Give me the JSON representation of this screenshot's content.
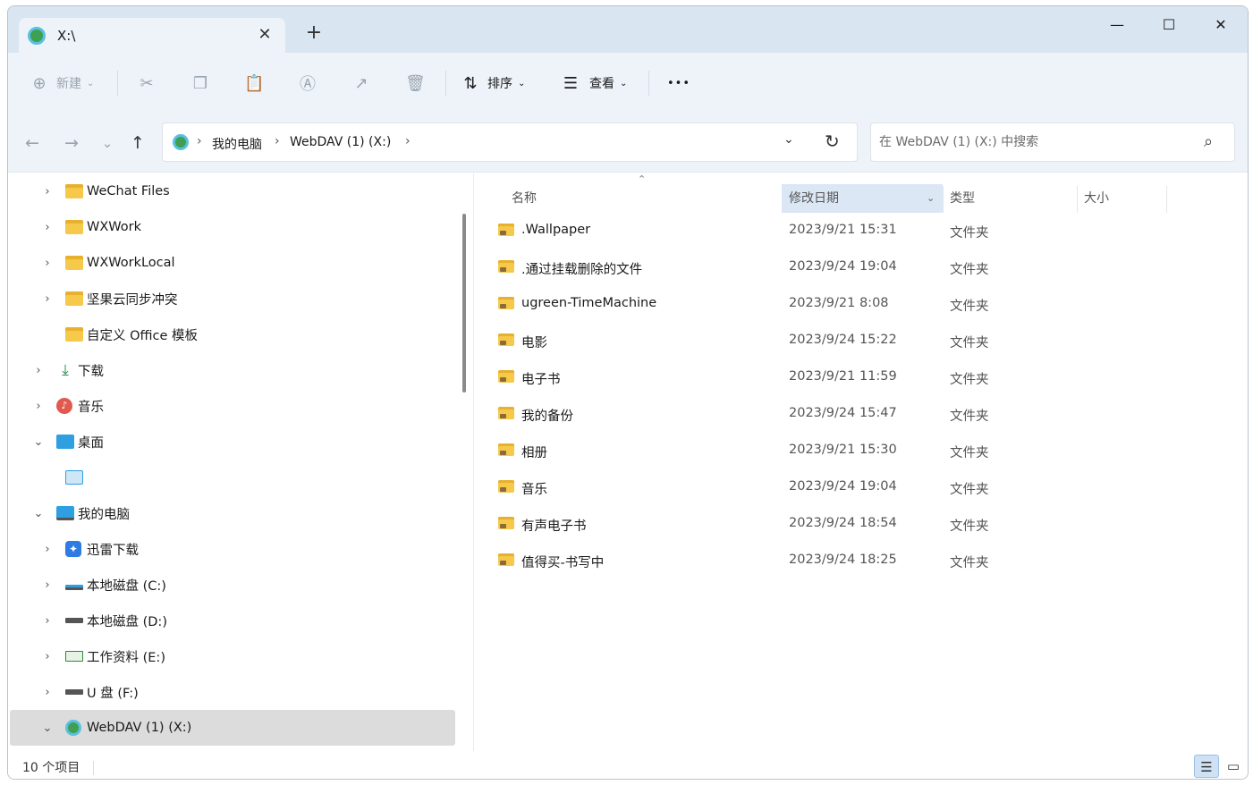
{
  "tab": {
    "title": "X:\\",
    "close": "✕",
    "new": "+"
  },
  "window_controls": {
    "minimize": "—",
    "maximize": "☐",
    "close": "✕"
  },
  "toolbar": {
    "new_label": "新建",
    "sort_label": "排序",
    "view_label": "查看",
    "more": "•••"
  },
  "address": {
    "crumbs": [
      "我的电脑",
      "WebDAV (1) (X:)"
    ],
    "sep": "›"
  },
  "search": {
    "placeholder": "在 WebDAV (1) (X:) 中搜索"
  },
  "sidebar": {
    "items": [
      {
        "label": "WeChat Files",
        "chevron": "›"
      },
      {
        "label": "WXWork",
        "chevron": "›"
      },
      {
        "label": "WXWorkLocal",
        "chevron": "›"
      },
      {
        "label": "坚果云同步冲突",
        "chevron": "›"
      },
      {
        "label": "自定义 Office 模板",
        "chevron": ""
      },
      {
        "label": "下载",
        "chevron": "›"
      },
      {
        "label": "音乐",
        "chevron": "›"
      },
      {
        "label": "桌面",
        "chevron": "⌄"
      },
      {
        "label": "",
        "chevron": ""
      },
      {
        "label": "我的电脑",
        "chevron": "⌄"
      },
      {
        "label": "迅雷下载",
        "chevron": "›"
      },
      {
        "label": "本地磁盘 (C:)",
        "chevron": "›"
      },
      {
        "label": "本地磁盘 (D:)",
        "chevron": "›"
      },
      {
        "label": "工作资料 (E:)",
        "chevron": "›"
      },
      {
        "label": "U 盘 (F:)",
        "chevron": "›"
      },
      {
        "label": "WebDAV (1) (X:)",
        "chevron": "⌄"
      }
    ]
  },
  "columns": {
    "name": "名称",
    "modified": "修改日期",
    "type": "类型",
    "size": "大小"
  },
  "files": [
    {
      "name": ".Wallpaper",
      "modified": "2023/9/21 15:31",
      "type": "文件夹"
    },
    {
      "name": ".通过挂载删除的文件",
      "modified": "2023/9/24 19:04",
      "type": "文件夹"
    },
    {
      "name": "ugreen-TimeMachine",
      "modified": "2023/9/21 8:08",
      "type": "文件夹"
    },
    {
      "name": "电影",
      "modified": "2023/9/24 15:22",
      "type": "文件夹"
    },
    {
      "name": "电子书",
      "modified": "2023/9/21 11:59",
      "type": "文件夹"
    },
    {
      "name": "我的备份",
      "modified": "2023/9/24 15:47",
      "type": "文件夹"
    },
    {
      "name": "相册",
      "modified": "2023/9/21 15:30",
      "type": "文件夹"
    },
    {
      "name": "音乐",
      "modified": "2023/9/24 19:04",
      "type": "文件夹"
    },
    {
      "name": "有声电子书",
      "modified": "2023/9/24 18:54",
      "type": "文件夹"
    },
    {
      "name": "值得买-书写中",
      "modified": "2023/9/24 18:25",
      "type": "文件夹"
    }
  ],
  "status": {
    "count": "10 个项目"
  }
}
